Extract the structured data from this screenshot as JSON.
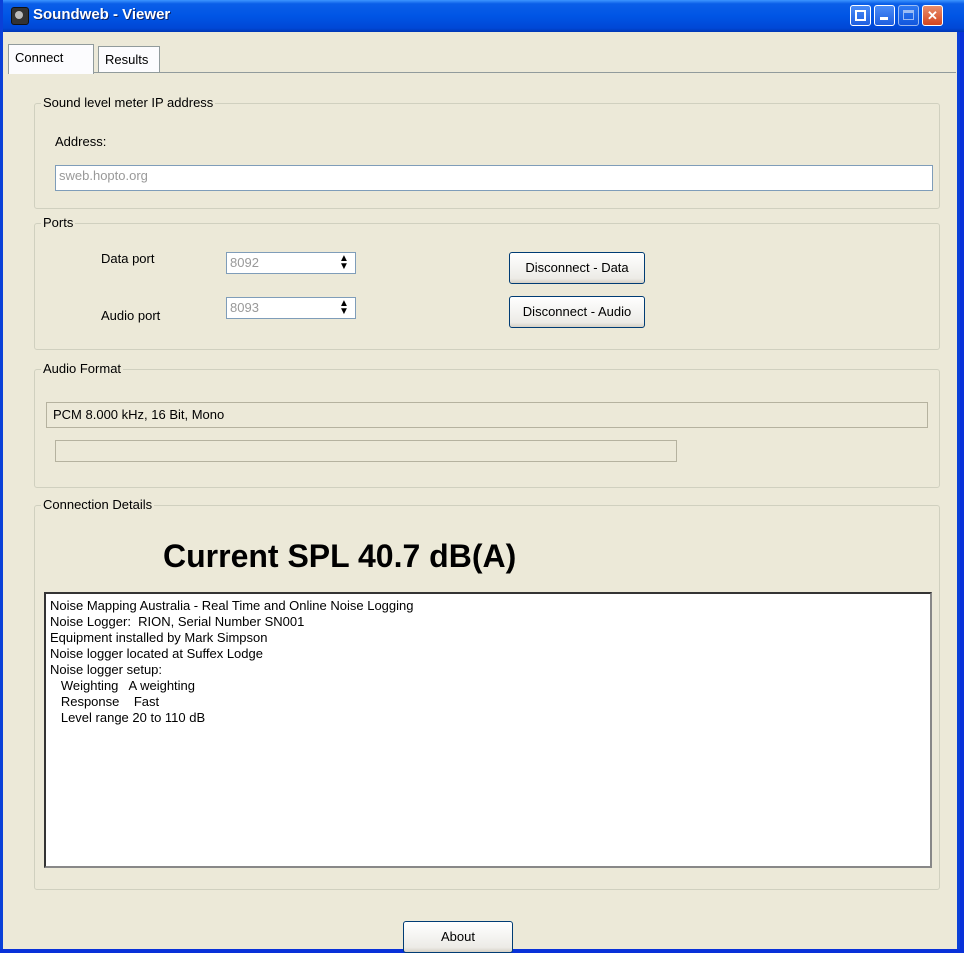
{
  "window": {
    "title": "Soundweb - Viewer"
  },
  "tabs": [
    {
      "label": "Connect"
    },
    {
      "label": "Results"
    }
  ],
  "ip_group": {
    "legend": "Sound level meter IP address",
    "address_label": "Address:",
    "address_value": "sweb.hopto.org"
  },
  "ports_group": {
    "legend": "Ports",
    "data_port_label": "Data port",
    "data_port_value": "8092",
    "audio_port_label": "Audio port",
    "audio_port_value": "8093",
    "disconnect_data_label": "Disconnect - Data",
    "disconnect_audio_label": "Disconnect - Audio"
  },
  "audio_group": {
    "legend": "Audio Format",
    "format_value": "PCM 8.000 kHz, 16 Bit, Mono"
  },
  "details_group": {
    "legend": "Connection Details",
    "spl_text": "Current SPL 40.7 dB(A)",
    "log_text": "Noise Mapping Australia - Real Time and Online Noise Logging\nNoise Logger:  RION, Serial Number SN001\nEquipment installed by Mark Simpson\nNoise logger located at Suffex Lodge\nNoise logger setup:\n   Weighting   A weighting\n   Response    Fast\n   Level range 20 to 110 dB"
  },
  "footer": {
    "about_label": "About"
  }
}
